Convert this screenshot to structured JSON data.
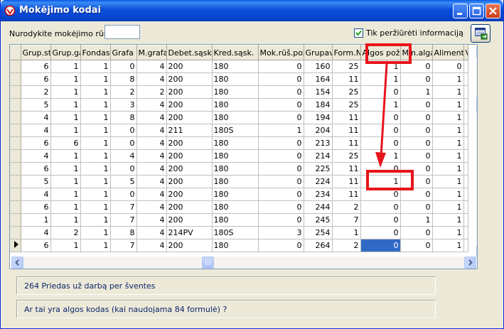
{
  "window": {
    "title": "Mokėjimo kodai"
  },
  "filter": {
    "code_label": "Nurodykite mokėjimo rūšį",
    "code_value": "",
    "info_only_label": "Tik peržiūrėti informaciją",
    "info_only_checked": true
  },
  "table": {
    "columns": [
      "Grup.st.",
      "Grup.ga",
      "Fondas",
      "Grafa",
      "M.grafa",
      "Debet.sąsk.",
      "Kred.sąsk.",
      "Mok.rūš.pož.",
      "Grupav.",
      "Form.N",
      "Algos pož.",
      "Min.alga",
      "Aliment.",
      "V"
    ],
    "rows": [
      [
        "6",
        "1",
        "1",
        "0",
        "4",
        "200",
        "180",
        "0",
        "160",
        "25",
        "1",
        "0",
        "0"
      ],
      [
        "6",
        "1",
        "1",
        "8",
        "4",
        "200",
        "180",
        "0",
        "164",
        "11",
        "1",
        "0",
        "1"
      ],
      [
        "2",
        "1",
        "1",
        "2",
        "2",
        "200",
        "180",
        "0",
        "154",
        "25",
        "0",
        "1",
        "1"
      ],
      [
        "5",
        "1",
        "1",
        "3",
        "4",
        "200",
        "180",
        "0",
        "184",
        "25",
        "1",
        "0",
        "1"
      ],
      [
        "4",
        "1",
        "1",
        "8",
        "4",
        "200",
        "180",
        "0",
        "194",
        "11",
        "0",
        "0",
        "1"
      ],
      [
        "4",
        "1",
        "1",
        "0",
        "4",
        "211",
        "180S",
        "1",
        "204",
        "11",
        "0",
        "0",
        "1"
      ],
      [
        "6",
        "6",
        "1",
        "0",
        "4",
        "200",
        "180",
        "0",
        "213",
        "11",
        "0",
        "0",
        "1"
      ],
      [
        "4",
        "1",
        "1",
        "4",
        "4",
        "200",
        "180",
        "0",
        "214",
        "25",
        "1",
        "0",
        "1"
      ],
      [
        "6",
        "1",
        "1",
        "0",
        "4",
        "200",
        "180",
        "0",
        "225",
        "11",
        "0",
        "0",
        "1"
      ],
      [
        "5",
        "1",
        "1",
        "5",
        "4",
        "200",
        "180",
        "0",
        "224",
        "11",
        "1",
        "0",
        "1"
      ],
      [
        "4",
        "1",
        "1",
        "0",
        "4",
        "200",
        "180",
        "0",
        "234",
        "11",
        "0",
        "0",
        "1"
      ],
      [
        "6",
        "1",
        "1",
        "7",
        "4",
        "200",
        "180",
        "0",
        "244",
        "2",
        "0",
        "0",
        "1"
      ],
      [
        "1",
        "1",
        "1",
        "7",
        "4",
        "200",
        "180",
        "0",
        "245",
        "7",
        "0",
        "1",
        "1"
      ],
      [
        "4",
        "2",
        "1",
        "8",
        "4",
        "214PV",
        "180S",
        "3",
        "254",
        "1",
        "0",
        "0",
        "1"
      ],
      [
        "6",
        "1",
        "1",
        "7",
        "4",
        "200",
        "180",
        "0",
        "264",
        "2",
        "0",
        "0",
        "1"
      ]
    ],
    "current_row": 14,
    "selected_column": 10,
    "highlighted_rows": [
      9
    ]
  },
  "status": {
    "line1": "264 Priedas už darbą per šventes",
    "line2": "Ar tai yra algos kodas (kai naudojama 84 formulė) ?"
  },
  "colors": {
    "selection": "#316ac5",
    "annotation": "#e8141c",
    "titlebar": "#0a4fd8"
  },
  "icons": {
    "app": "app-logo-icon",
    "report": "report-preview-icon",
    "minimize": "minimize-icon",
    "maximize": "maximize-icon",
    "close": "close-icon"
  }
}
